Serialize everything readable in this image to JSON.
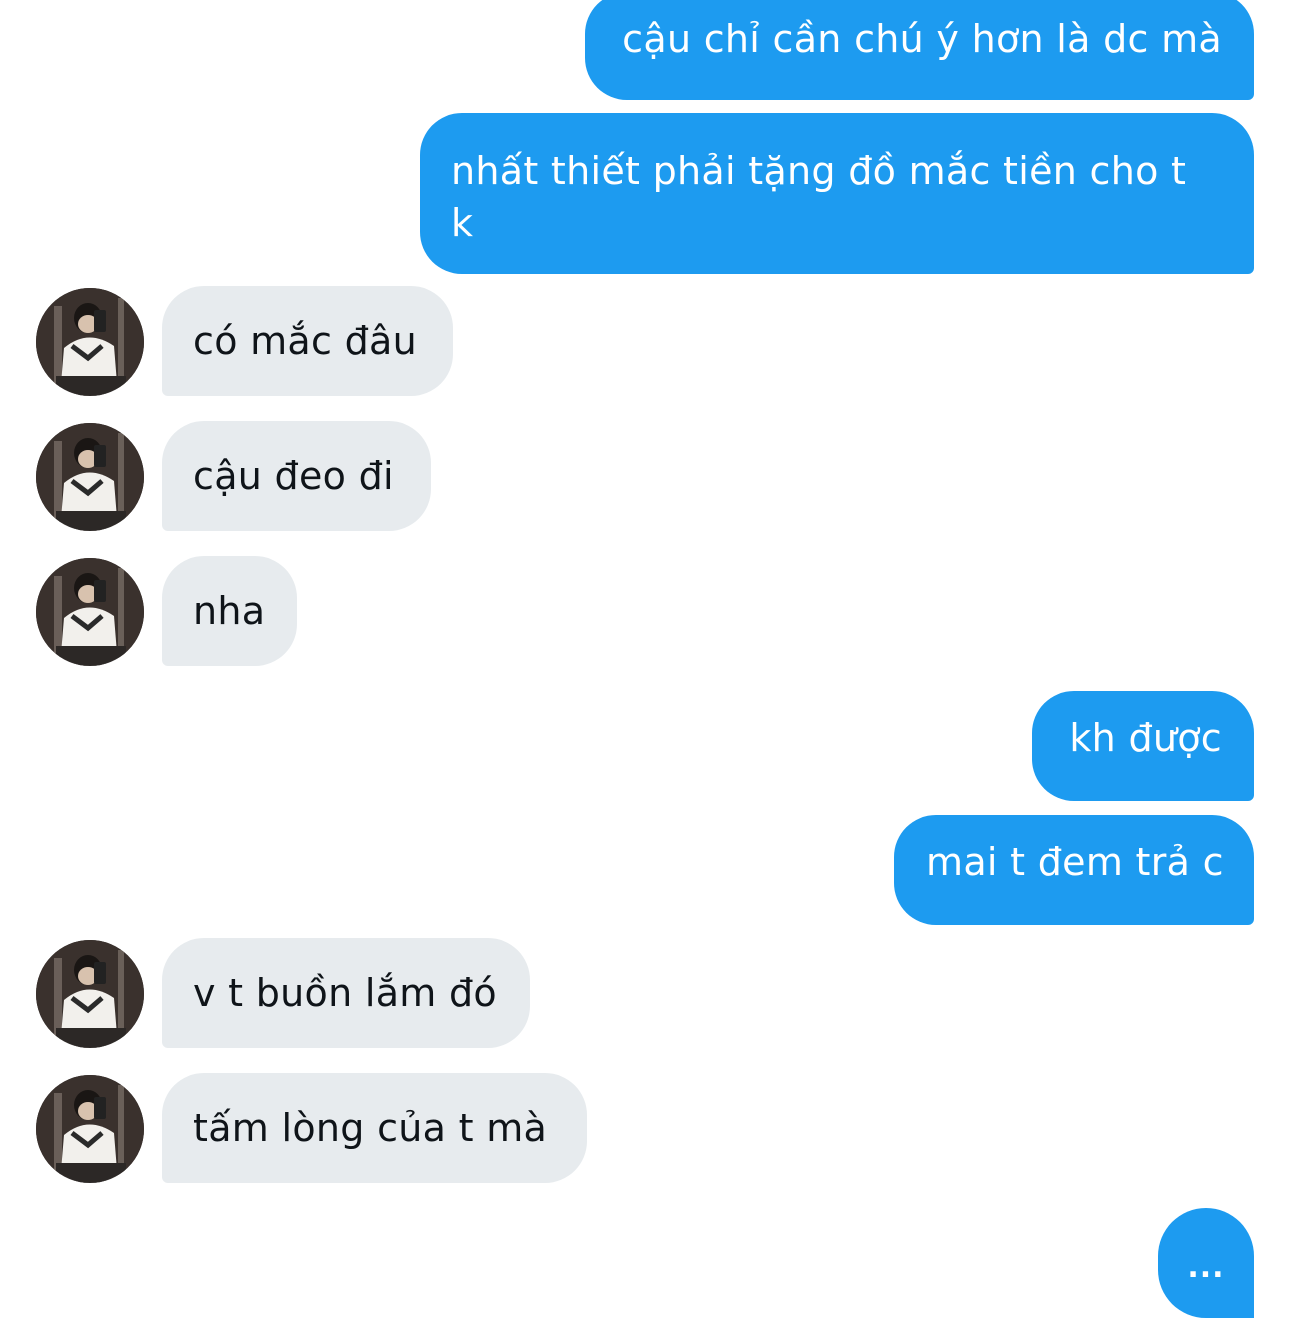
{
  "conversation": {
    "messages": [
      {
        "direction": "outgoing",
        "text": "cậu chỉ cần chú ý hơn là dc mà"
      },
      {
        "direction": "outgoing",
        "text": "nhất thiết phải tặng đồ mắc tiền cho t k"
      },
      {
        "direction": "incoming",
        "text": "có mắc đâu"
      },
      {
        "direction": "incoming",
        "text": "cậu đeo đi"
      },
      {
        "direction": "incoming",
        "text": "nha"
      },
      {
        "direction": "outgoing",
        "text": "kh được"
      },
      {
        "direction": "outgoing",
        "text": "mai t đem trả c"
      },
      {
        "direction": "incoming",
        "text": "v t buồn lắm đó"
      },
      {
        "direction": "incoming",
        "text": "tấm lòng của t mà"
      }
    ],
    "typing_indicator": "..."
  },
  "colors": {
    "outgoing_bubble": "#1d9bf0",
    "incoming_bubble": "#e7ebee",
    "incoming_text": "#0f1419",
    "background": "#ffffff"
  },
  "icons": {
    "avatar": "user-avatar-photo"
  }
}
